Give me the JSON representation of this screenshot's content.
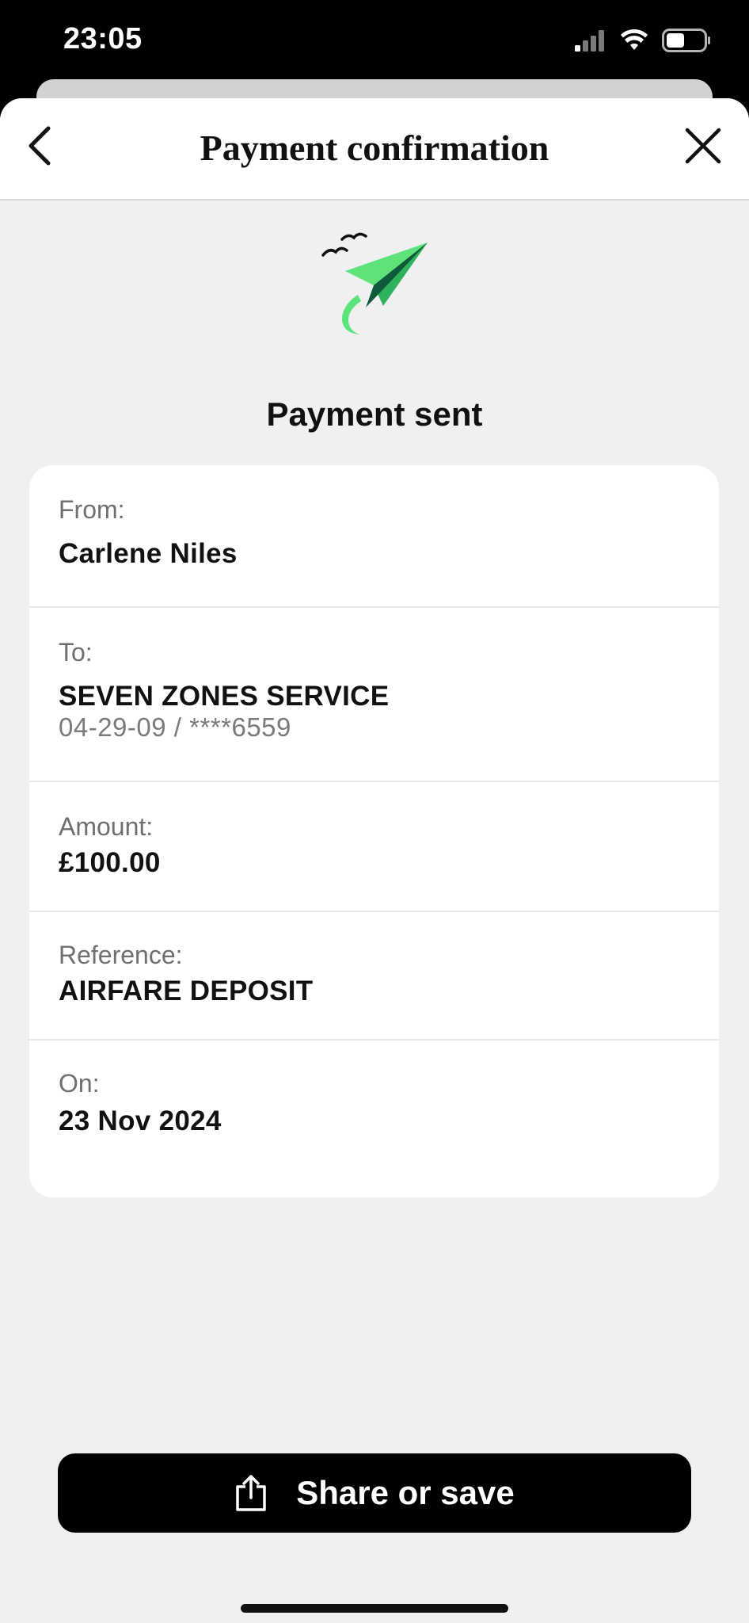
{
  "status_bar": {
    "time": "23:05",
    "icons": [
      "signal-icon",
      "wifi-icon",
      "battery-icon"
    ]
  },
  "nav": {
    "title": "Payment confirmation",
    "back_icon": "chevron-left-icon",
    "close_icon": "close-icon"
  },
  "headline": "Payment sent",
  "details": {
    "from": {
      "label": "From:",
      "value": "Carlene Niles"
    },
    "to": {
      "label": "To:",
      "value": "SEVEN ZONES SERVICE",
      "account": "04-29-09 / ****6559"
    },
    "amount": {
      "label": "Amount:",
      "value": "£100.00"
    },
    "reference": {
      "label": "Reference:",
      "value": "AIRFARE DEPOSIT"
    },
    "date": {
      "label": "On:",
      "value": "23 Nov 2024"
    }
  },
  "actions": {
    "share_label": "Share or save",
    "share_icon": "share-icon"
  },
  "colors": {
    "accent_green": "#5ee27a",
    "dark_green": "#0e5a3a",
    "button_bg": "#000000",
    "sheet_bg": "#f0f0f0"
  }
}
